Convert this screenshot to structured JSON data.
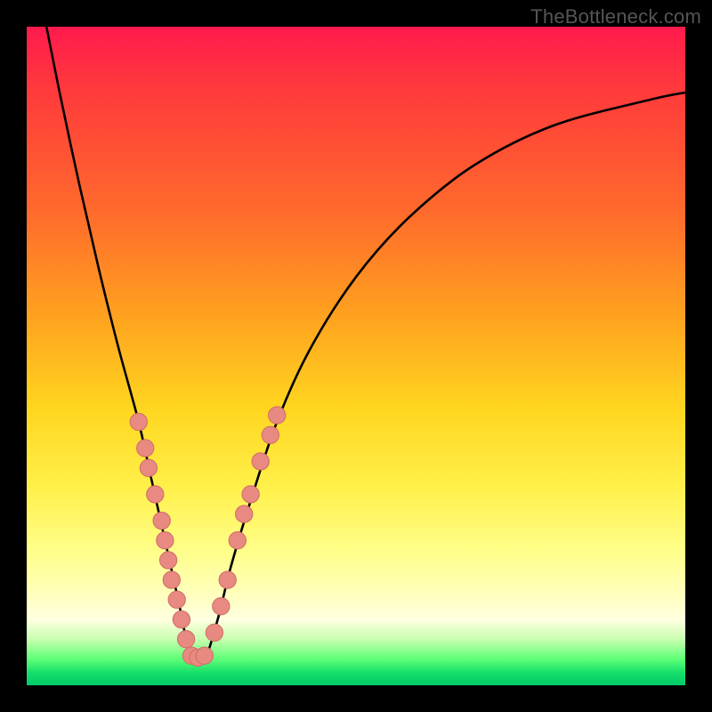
{
  "watermark": "TheBottleneck.com",
  "colors": {
    "curve": "#000000",
    "marker_fill": "#e88a82",
    "marker_stroke": "#d27068"
  },
  "chart_data": {
    "type": "line",
    "title": "",
    "xlabel": "",
    "ylabel": "",
    "xlim": [
      0,
      100
    ],
    "ylim": [
      0,
      100
    ],
    "note": "Axes are unlabeled; values are read as percentages of the plot area width (x) and height (y), with y=0 at the bottom and y=100 at the top. The curve is a V-shaped bottleneck profile with its minimum near x≈25.",
    "series": [
      {
        "name": "bottleneck-curve",
        "x": [
          3,
          5,
          8,
          11,
          14,
          17,
          19,
          21,
          23,
          25,
          27,
          29,
          31,
          34,
          38,
          43,
          50,
          58,
          68,
          80,
          95,
          100
        ],
        "y": [
          100,
          90,
          76,
          63,
          51,
          40,
          31,
          22,
          13,
          4,
          4,
          10,
          18,
          28,
          40,
          51,
          62,
          71,
          79,
          85,
          89,
          90
        ]
      }
    ],
    "markers": {
      "name": "highlighted-segments",
      "comment": "Pink capsule-like markers clustered along the lower portion of both arms near the trough.",
      "points": [
        {
          "x": 17.0,
          "y": 40.0
        },
        {
          "x": 18.0,
          "y": 36.0
        },
        {
          "x": 18.5,
          "y": 33.0
        },
        {
          "x": 19.5,
          "y": 29.0
        },
        {
          "x": 20.5,
          "y": 25.0
        },
        {
          "x": 21.0,
          "y": 22.0
        },
        {
          "x": 21.5,
          "y": 19.0
        },
        {
          "x": 22.0,
          "y": 16.0
        },
        {
          "x": 22.8,
          "y": 13.0
        },
        {
          "x": 23.5,
          "y": 10.0
        },
        {
          "x": 24.2,
          "y": 7.0
        },
        {
          "x": 25.0,
          "y": 4.5
        },
        {
          "x": 26.0,
          "y": 4.2
        },
        {
          "x": 27.0,
          "y": 4.5
        },
        {
          "x": 28.5,
          "y": 8.0
        },
        {
          "x": 29.5,
          "y": 12.0
        },
        {
          "x": 30.5,
          "y": 16.0
        },
        {
          "x": 32.0,
          "y": 22.0
        },
        {
          "x": 33.0,
          "y": 26.0
        },
        {
          "x": 34.0,
          "y": 29.0
        },
        {
          "x": 35.5,
          "y": 34.0
        },
        {
          "x": 37.0,
          "y": 38.0
        },
        {
          "x": 38.0,
          "y": 41.0
        }
      ],
      "radius_pct": 1.3
    }
  }
}
